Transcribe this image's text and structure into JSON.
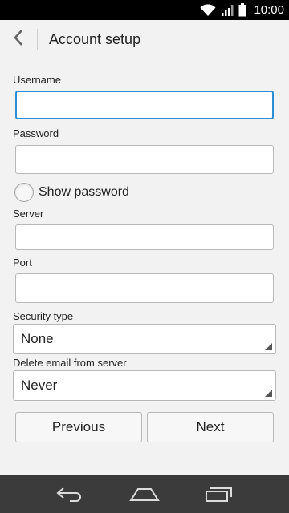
{
  "status_bar": {
    "time": "10:00",
    "icons": [
      "wifi-icon",
      "signal-icon",
      "battery-icon"
    ]
  },
  "app_bar": {
    "title": "Account setup",
    "back_icon": "chevron-left-icon"
  },
  "form": {
    "username": {
      "label": "Username",
      "value": ""
    },
    "password": {
      "label": "Password",
      "value": ""
    },
    "show_password": {
      "label": "Show password",
      "checked": false
    },
    "server": {
      "label": "Server",
      "value": ""
    },
    "port": {
      "label": "Port",
      "value": ""
    },
    "security_type": {
      "label": "Security type",
      "value": "None"
    },
    "delete_email": {
      "label": "Delete email from server",
      "value": "Never"
    }
  },
  "buttons": {
    "previous": "Previous",
    "next": "Next"
  },
  "nav_bar": {
    "icons": [
      "back-nav-icon",
      "home-nav-icon",
      "recent-apps-icon"
    ]
  },
  "colors": {
    "focus_border": "#2c8fd6",
    "background": "#f2f2f2",
    "nav_bar": "#3b3b3b"
  }
}
